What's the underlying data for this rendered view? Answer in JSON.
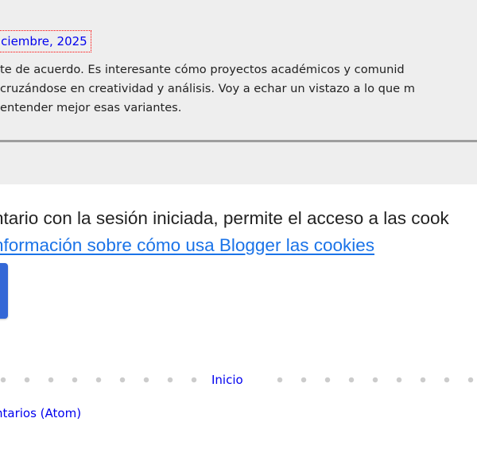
{
  "comment": {
    "date_link": "iciembre, 2025",
    "body_lines": [
      "te de acuerdo. Es interesante cómo proyectos académicos y comunid",
      " cruzándose en creatividad y análisis. Voy a echar un vistazo a lo que m",
      "entender mejor esas variantes."
    ]
  },
  "cookie_notice": {
    "text": "ntario con la sesión iniciada, permite el acceso a las cook",
    "link_text": "nformación sobre cómo usa Blogger las cookies"
  },
  "navigation": {
    "home_link": "Inicio"
  },
  "feed": {
    "link_text": "ntarios (Atom)"
  },
  "colors": {
    "comment_background": "#eeeeee",
    "link": "#0000ee",
    "accent_link": "#1a73e8",
    "button": "#3367d6",
    "divider": "#9e9e9e"
  }
}
